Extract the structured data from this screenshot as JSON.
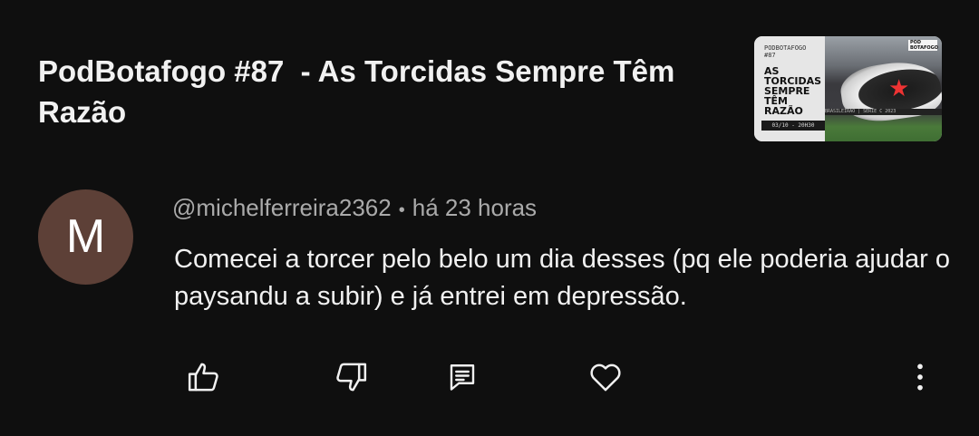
{
  "video": {
    "title": "PodBotafogo #87  - As Torcidas Sempre Têm Razão",
    "thumbnail": {
      "small_text": "PODBOTAFOGO\n#87",
      "big_text": "AS\nTORCIDAS\nSEMPRE\nTÊM\nRAZÃO",
      "date_text": "03/10 - 20H30",
      "logo_text": "POD\nBOTAFOGO",
      "banner_text": "BRASILEIRÃO | SÉRIE C 2023"
    }
  },
  "comment": {
    "avatar_letter": "M",
    "avatar_color": "#5d4037",
    "author": "@michelferreira2362",
    "separator": "•",
    "time": "há 23 horas",
    "text": "Comecei a torcer pelo belo um dia desses (pq ele poderia ajudar o paysandu a subir) e já entrei em depressão."
  },
  "actions": {
    "like_icon": "thumbs-up-icon",
    "dislike_icon": "thumbs-down-icon",
    "reply_icon": "reply-comment-icon",
    "heart_icon": "heart-icon",
    "more_icon": "more-vertical-icon"
  },
  "colors": {
    "background": "#0f0f0f",
    "primary_text": "#f1f1f1",
    "secondary_text": "#aaaaaa"
  }
}
